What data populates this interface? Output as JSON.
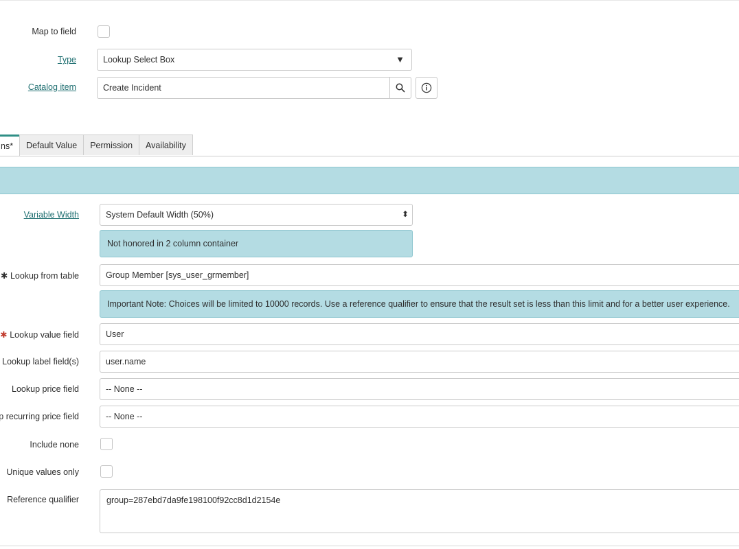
{
  "header": {
    "map_to_field_label": "Map to field",
    "type_label": "Type",
    "type_value": "Lookup Select Box",
    "catalog_item_label": "Catalog item",
    "catalog_item_value": "Create Incident"
  },
  "tabs": [
    {
      "label": "ns*"
    },
    {
      "label": "Default Value"
    },
    {
      "label": "Permission"
    },
    {
      "label": "Availability"
    }
  ],
  "form": {
    "variable_width_label": "Variable Width",
    "variable_width_value": "System Default Width (50%)",
    "variable_width_note": "Not honored in 2 column container",
    "lookup_table_label": "Lookup from table",
    "lookup_table_value": "Group Member [sys_user_grmember]",
    "lookup_table_note": "Important Note: Choices will be limited to 10000 records. Use a reference qualifier to ensure that the result set is less than this limit and for a better user experience.",
    "lookup_value_label": "Lookup value field",
    "lookup_value_value": "User",
    "lookup_label_fields_label": "Lookup label field(s)",
    "lookup_label_fields_value": "user.name",
    "lookup_price_label": "Lookup price field",
    "lookup_price_value": "-- None --",
    "recurring_price_label": "p recurring price field",
    "recurring_price_value": "-- None --",
    "include_none_label": "Include none",
    "unique_values_label": "Unique values only",
    "reference_qualifier_label": "Reference qualifier",
    "reference_qualifier_value": "group=287ebd7da9fe198100f92cc8d1d2154e"
  },
  "icons": {
    "required_marker": "✱",
    "dropdown_arrow": "▼",
    "select_arrows": "⬍"
  }
}
